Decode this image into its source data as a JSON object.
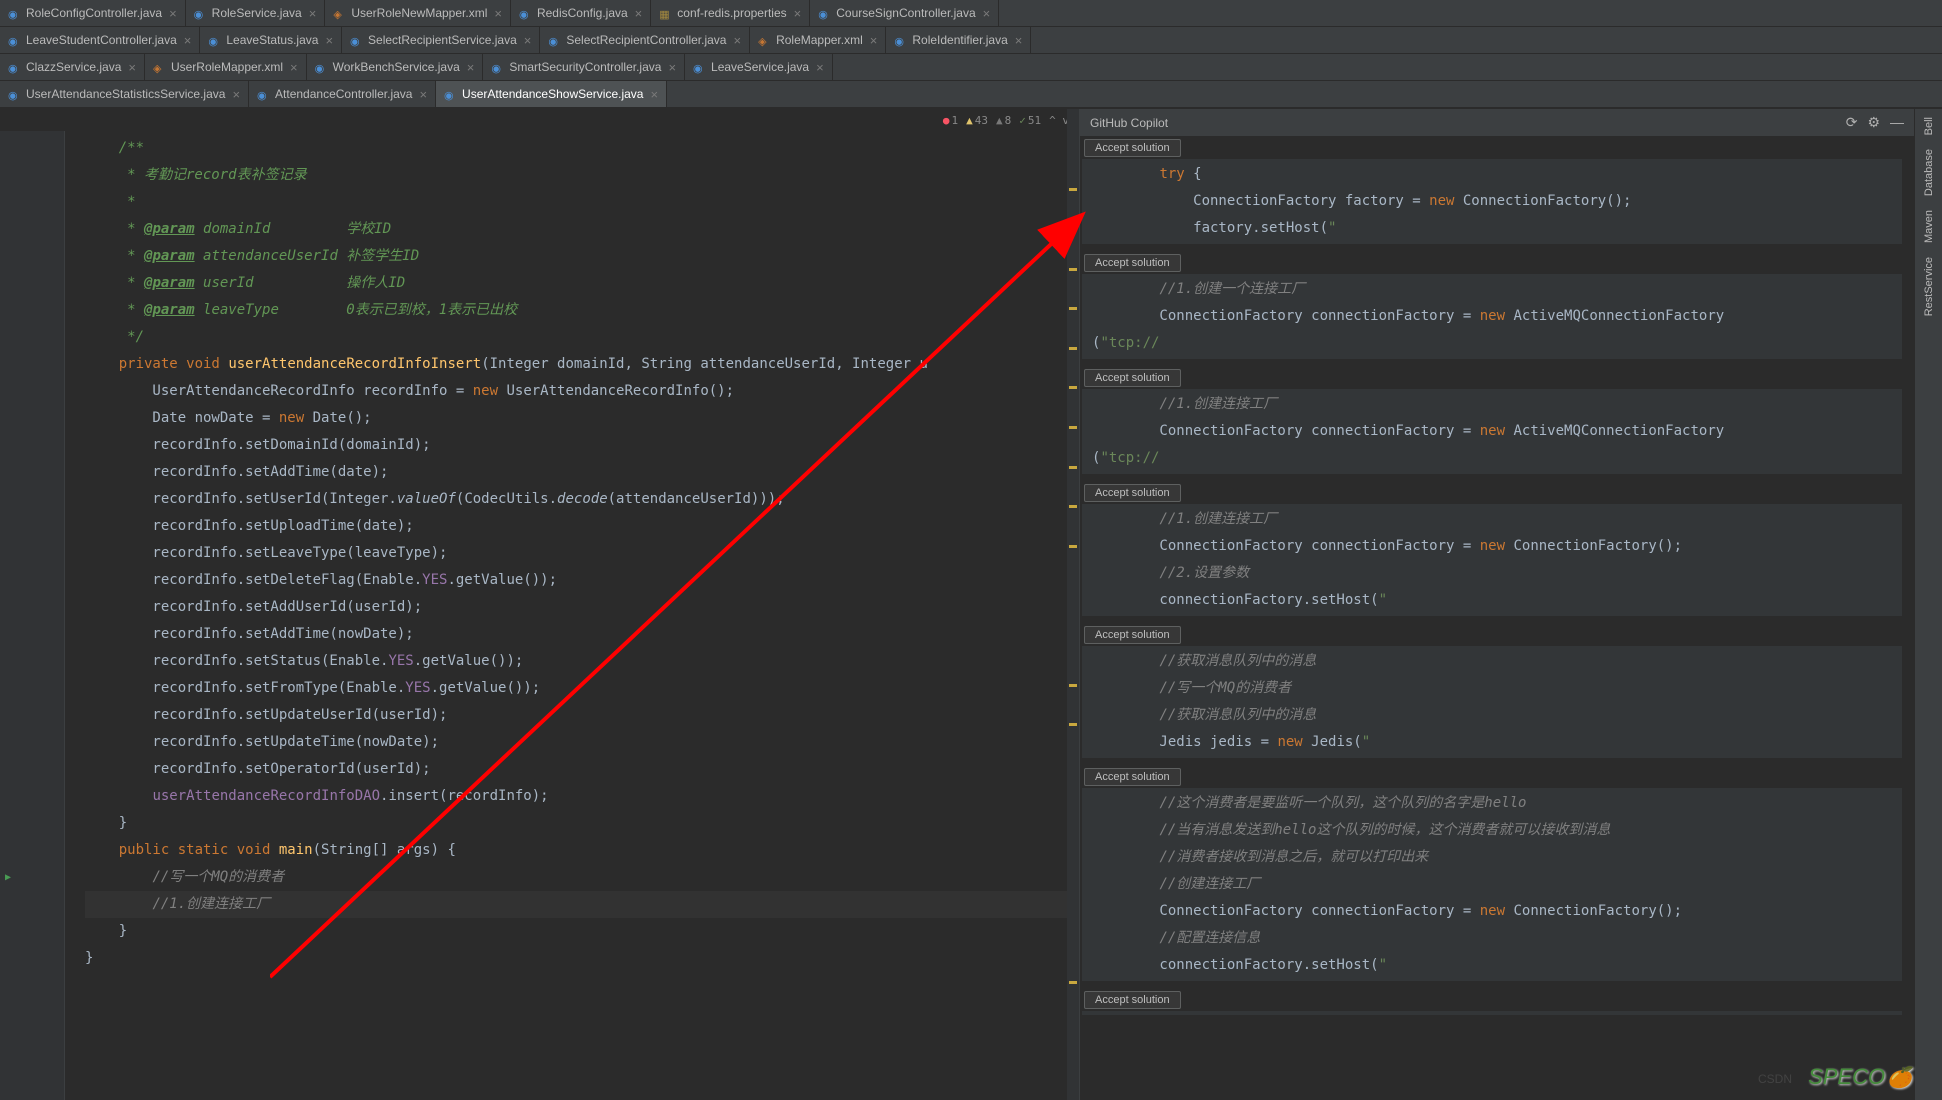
{
  "tabs": {
    "row1": [
      {
        "label": "RoleConfigController.java",
        "ic": "java"
      },
      {
        "label": "RoleService.java",
        "ic": "java"
      },
      {
        "label": "UserRoleNewMapper.xml",
        "ic": "xml"
      },
      {
        "label": "RedisConfig.java",
        "ic": "java"
      },
      {
        "label": "conf-redis.properties",
        "ic": "prop"
      },
      {
        "label": "CourseSignController.java",
        "ic": "java"
      }
    ],
    "row2": [
      {
        "label": "LeaveStudentController.java",
        "ic": "java"
      },
      {
        "label": "LeaveStatus.java",
        "ic": "java"
      },
      {
        "label": "SelectRecipientService.java",
        "ic": "java"
      },
      {
        "label": "SelectRecipientController.java",
        "ic": "java"
      },
      {
        "label": "RoleMapper.xml",
        "ic": "xml"
      },
      {
        "label": "RoleIdentifier.java",
        "ic": "java"
      }
    ],
    "row3": [
      {
        "label": "ClazzService.java",
        "ic": "java"
      },
      {
        "label": "UserRoleMapper.xml",
        "ic": "xml"
      },
      {
        "label": "WorkBenchService.java",
        "ic": "java"
      },
      {
        "label": "SmartSecurityController.java",
        "ic": "java"
      },
      {
        "label": "LeaveService.java",
        "ic": "java"
      }
    ],
    "row4": [
      {
        "label": "UserAttendanceStatisticsService.java",
        "ic": "java"
      },
      {
        "label": "AttendanceController.java",
        "ic": "java"
      },
      {
        "label": "UserAttendanceShowService.java",
        "ic": "java",
        "active": true
      }
    ]
  },
  "stats": {
    "err": "1",
    "warn": "43",
    "weak": "8",
    "typo": "51",
    "arrows": "^ v"
  },
  "gutter_start": 0,
  "lines": [
    {
      "n": "",
      "h": "    <span class='doc'>/**</span>"
    },
    {
      "n": "",
      "h": "    <span class='doc'> * 考勤记record表补签记录</span>"
    },
    {
      "n": "",
      "h": "    <span class='doc'> *</span>"
    },
    {
      "n": "",
      "h": "    <span class='doc'> * </span><span class='doctag'>@param</span><span class='doc'> domainId         学校ID</span>"
    },
    {
      "n": "",
      "h": "    <span class='doc'> * </span><span class='doctag'>@param</span><span class='doc'> attendanceUserId 补签学生ID</span>"
    },
    {
      "n": "",
      "h": "    <span class='doc'> * </span><span class='doctag'>@param</span><span class='doc'> userId           操作人ID</span>"
    },
    {
      "n": "",
      "h": "    <span class='doc'> * </span><span class='doctag'>@param</span><span class='doc'> leaveType        0表示已到校，1表示已出校</span>"
    },
    {
      "n": "",
      "h": "    <span class='doc'> */</span>"
    },
    {
      "n": "",
      "h": "    <span class='kw'>private void</span> <span class='fn'>userAttendanceRecordInfoInsert</span>(Integer domainId, String attendanceUserId, Integer u"
    },
    {
      "n": "",
      "h": "        UserAttendanceRecordInfo recordInfo = <span class='kw'>new</span> UserAttendanceRecordInfo();"
    },
    {
      "n": "",
      "h": "        Date nowDate = <span class='kw'>new</span> Date();"
    },
    {
      "n": "",
      "h": "        recordInfo.setDomainId(domainId);"
    },
    {
      "n": "",
      "h": "        recordInfo.setAddTime(date);"
    },
    {
      "n": "",
      "h": "        recordInfo.setUserId(Integer.<span class='static-call'>valueOf</span>(CodecUtils.<span class='static-call'>decode</span>(attendanceUserId)));"
    },
    {
      "n": "",
      "h": "        recordInfo.setUploadTime(date);"
    },
    {
      "n": "",
      "h": "        recordInfo.setLeaveType(leaveType);"
    },
    {
      "n": "",
      "h": "        recordInfo.setDeleteFlag(Enable.<span class='fld'>YES</span>.getValue());"
    },
    {
      "n": "",
      "h": "        recordInfo.setAddUserId(userId);"
    },
    {
      "n": "",
      "h": "        recordInfo.setAddTime(nowDate);"
    },
    {
      "n": "",
      "h": "        recordInfo.setStatus(Enable.<span class='fld'>YES</span>.getValue());"
    },
    {
      "n": "",
      "h": "        recordInfo.setFromType(Enable.<span class='fld'>YES</span>.getValue());"
    },
    {
      "n": "",
      "h": "        recordInfo.setUpdateUserId(userId);"
    },
    {
      "n": "",
      "h": "        recordInfo.setUpdateTime(nowDate);"
    },
    {
      "n": "",
      "h": "        recordInfo.setOperatorId(userId);"
    },
    {
      "n": "",
      "h": "        <span class='fld'>userAttendanceRecordInfoDAO</span>.insert(recordInfo);"
    },
    {
      "n": "",
      "h": "    }"
    },
    {
      "n": "",
      "h": ""
    },
    {
      "n": "",
      "run": true,
      "h": "    <span class='kw'>public static void</span> <span class='fn'>main</span>(String[] args) {"
    },
    {
      "n": "",
      "h": "        <span class='cmt'>//写一个MQ的消费者</span>"
    },
    {
      "n": "",
      "cur": true,
      "h": "        <span class='cmt'>//1.创建连接工厂</span>"
    },
    {
      "n": "",
      "h": "    }"
    },
    {
      "n": "",
      "h": "}"
    }
  ],
  "copilot": {
    "title": "GitHub Copilot",
    "accept_label": "Accept solution",
    "solutions": [
      {
        "code": "        <span class='kw'>try</span> {\n            ConnectionFactory factory = <span class='kw'>new</span> ConnectionFactory();\n            factory.setHost(<span class='str'>\"</span>"
      },
      {
        "code": "        <span class='cmt'>//1.创建一个连接工厂</span>\n        ConnectionFactory connectionFactory = <span class='kw'>new</span> ActiveMQConnectionFactory\n(<span class='str'>\"tcp://</span>"
      },
      {
        "code": "        <span class='cmt'>//1.创建连接工厂</span>\n        ConnectionFactory connectionFactory = <span class='kw'>new</span> ActiveMQConnectionFactory\n(<span class='str'>\"tcp://</span>"
      },
      {
        "code": "        <span class='cmt'>//1.创建连接工厂</span>\n        ConnectionFactory connectionFactory = <span class='kw'>new</span> ConnectionFactory();\n        <span class='cmt'>//2.设置参数</span>\n        connectionFactory.setHost(<span class='str'>\"</span>"
      },
      {
        "code": "        <span class='cmt'>//获取消息队列中的消息</span>\n        <span class='cmt'>//写一个MQ的消费者</span>\n        <span class='cmt'>//获取消息队列中的消息</span>\n        Jedis jedis = <span class='kw'>new</span> Jedis(<span class='str'>\"</span>"
      },
      {
        "code": "        <span class='cmt'>//这个消费者是要监听一个队列，这个队列的名字是hello</span>\n        <span class='cmt'>//当有消息发送到hello这个队列的时候，这个消费者就可以接收到消息</span>\n        <span class='cmt'>//消费者接收到消息之后，就可以打印出来</span>\n        <span class='cmt'>//创建连接工厂</span>\n        ConnectionFactory connectionFactory = <span class='kw'>new</span> ConnectionFactory();\n        <span class='cmt'>//配置连接信息</span>\n        connectionFactory.setHost(<span class='str'>\"</span>"
      },
      {
        "code": ""
      }
    ]
  },
  "rail": [
    "Bell",
    "Database",
    "Maven",
    "RestService"
  ],
  "watermark": "SPECO",
  "csdn": "CSDN"
}
